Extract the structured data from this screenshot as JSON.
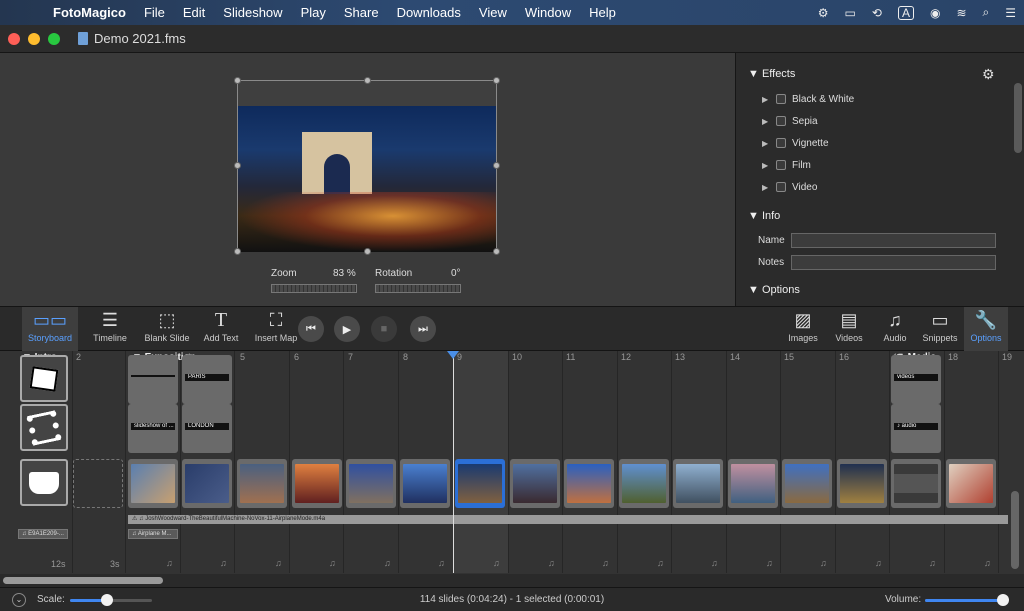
{
  "menubar": {
    "apple_icon": "apple-icon",
    "items": [
      "FotoMagico",
      "File",
      "Edit",
      "Slideshow",
      "Play",
      "Share",
      "Downloads",
      "View",
      "Window",
      "Help"
    ],
    "input_source": "A"
  },
  "window": {
    "title": "Demo 2021.fms",
    "colors": {
      "close": "#fe5f57",
      "minimize": "#febc2e",
      "zoom": "#28c840"
    }
  },
  "stage": {
    "zoom_label": "Zoom",
    "zoom_value": "83 %",
    "rotation_label": "Rotation",
    "rotation_value": "0°"
  },
  "inspector": {
    "effects_header": "▼ Effects",
    "effects": [
      "Black & White",
      "Sepia",
      "Vignette",
      "Film",
      "Video"
    ],
    "info_header": "▼ Info",
    "name_label": "Name",
    "notes_label": "Notes",
    "options_header": "▼ Options"
  },
  "toolbar": {
    "storyboard": "Storyboard",
    "timeline": "Timeline",
    "blank_slide": "Blank Slide",
    "add_text": "Add Text",
    "insert_map": "Insert Map",
    "images": "Images",
    "videos": "Videos",
    "audio": "Audio",
    "snippets": "Snippets",
    "options": "Options",
    "accent": "#5aa0ff"
  },
  "timeline": {
    "numbers": [
      "2",
      "4",
      "5",
      "6",
      "7",
      "8",
      "9",
      "10",
      "11",
      "12",
      "13",
      "14",
      "15",
      "16",
      "17",
      "18",
      "19"
    ],
    "chapters": {
      "intro": "▼ Intro",
      "exposition": "▼ Exposition",
      "media": "▼ Media"
    },
    "title_captions": {
      "paris": "PARIS",
      "london": "LONDON",
      "caption_a": "slideshow of ...",
      "videos": "videos",
      "audio": "♪ audio"
    },
    "audio_track": "⚠ ♫ JoshWoodward-TheBeautifulMachine-NoVox-11-AirplaneMode.m4a",
    "chip_left": "♫ E9A1E209-...",
    "chip_airplane": "♫ Airplane M...",
    "durations": {
      "first": "12s",
      "second": "3s"
    }
  },
  "status": {
    "scale_label": "Scale:",
    "summary": "114 slides (0:04:24) - 1 selected (0:00:01)",
    "volume_label": "Volume:",
    "scale_level": 0.45,
    "volume_level": 0.95
  }
}
